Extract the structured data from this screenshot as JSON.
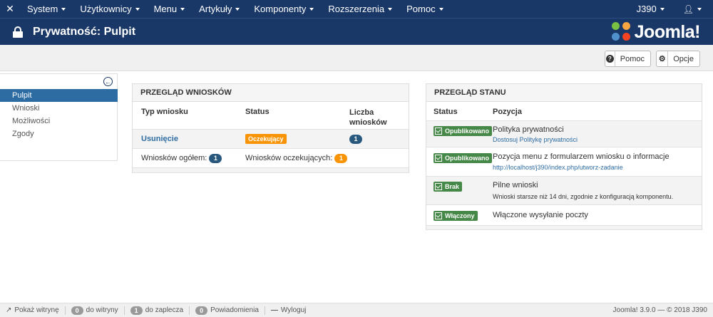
{
  "navbar": {
    "logo_icon": "joomla-icon",
    "menus": [
      "System",
      "Użytkownicy",
      "Menu",
      "Artykuły",
      "Komponenty",
      "Rozszerzenia",
      "Pomoc"
    ],
    "site_name": "J390",
    "user_icon": "user-icon"
  },
  "header": {
    "title": "Prywatność: Pulpit",
    "icon": "lock-icon",
    "logo_text": "Joomla!"
  },
  "toolbar": {
    "help_label": "Pomoc",
    "options_label": "Opcje"
  },
  "sidebar": {
    "items": [
      "Pulpit",
      "Wnioski",
      "Możliwości",
      "Zgody"
    ],
    "active": "Pulpit"
  },
  "requests_panel": {
    "title": "PRZEGLĄD WNIOSKÓW",
    "columns": [
      "Typ wniosku",
      "Status",
      "Liczba wniosków"
    ],
    "rows": [
      {
        "type": "Usunięcie",
        "status": "Oczekujący",
        "count": "1"
      }
    ],
    "totals": {
      "total_label": "Wniosków ogółem:",
      "total_value": "1",
      "pending_label": "Wniosków oczekujących:",
      "pending_value": "1"
    }
  },
  "status_panel": {
    "title": "PRZEGLĄD STANU",
    "columns": [
      "Status",
      "Pozycja"
    ],
    "rows": [
      {
        "status": "Opublikowano",
        "title": "Polityka prywatności",
        "sub": "Dostosuj Politykę prywatności"
      },
      {
        "status": "Opublikowano",
        "title": "Pozycja menu z formularzem wniosku o informacje",
        "sub": "http://localhost/j390/index.php/utworz-zadanie"
      },
      {
        "status": "Brak",
        "title": "Pilne wnioski",
        "sub": "Wnioski starsze niż 14 dni, zgodnie z konfiguracją komponentu."
      },
      {
        "status": "Włączony",
        "title": "Włączone wysyłanie poczty",
        "sub": ""
      }
    ]
  },
  "footer": {
    "view_site": "Pokaż witrynę",
    "site_count": "0",
    "site_label": "do witryny",
    "admin_count": "1",
    "admin_label": "do zaplecza",
    "msg_count": "0",
    "msg_label": "Powiadomienia",
    "logout": "Wyloguj",
    "version": "Joomla! 3.9.0  —  © 2018 J390"
  },
  "colors": {
    "navbar": "#1a3867",
    "accent": "#2d6ca2",
    "orange": "#f89406",
    "green": "#468847"
  }
}
